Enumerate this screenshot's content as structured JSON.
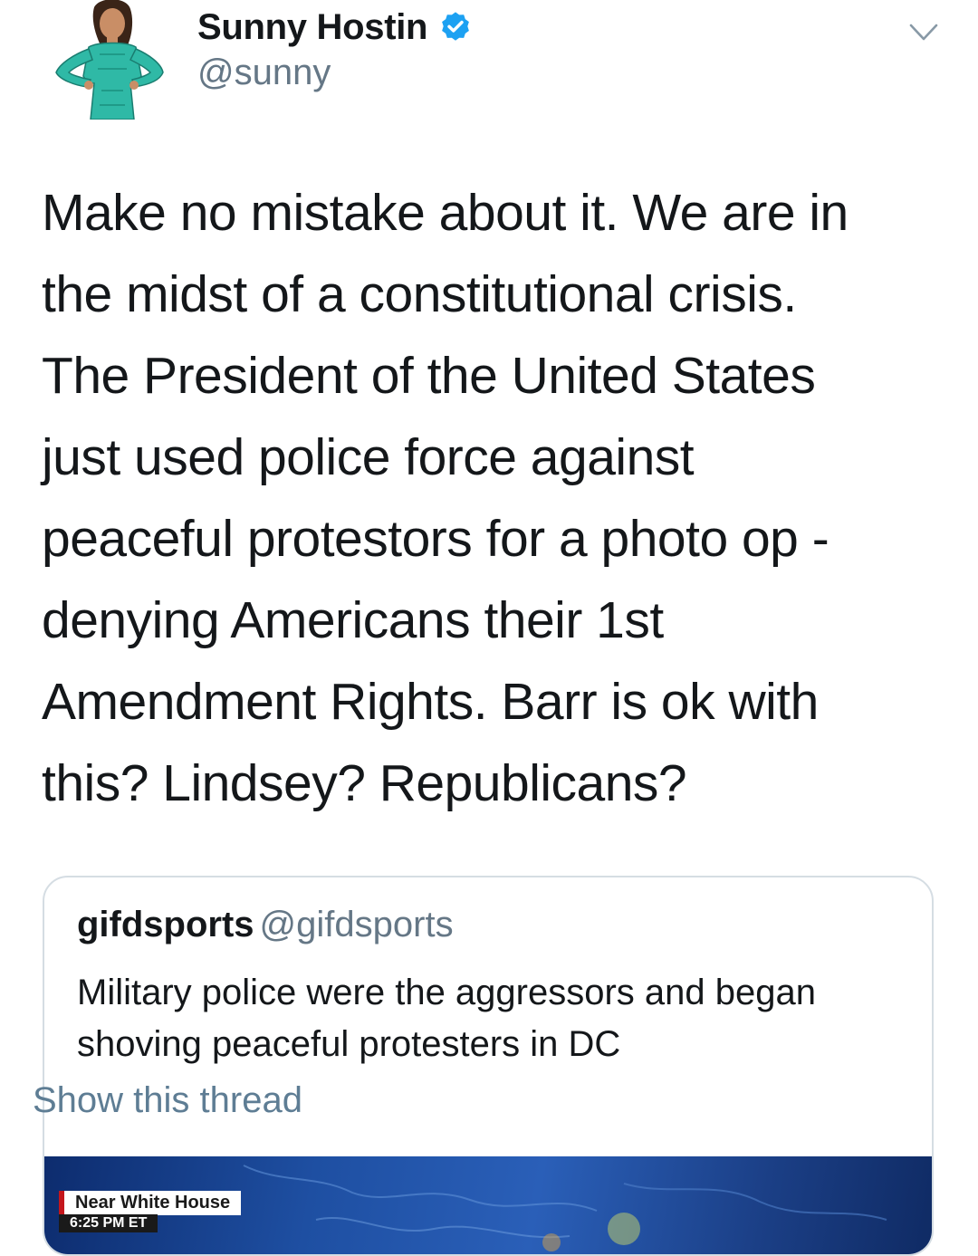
{
  "author": {
    "display_name": "Sunny Hostin",
    "handle": "@sunny",
    "verified": true,
    "avatar_icon": "illustrated-woman-avatar"
  },
  "menu": {
    "icon": "chevron-down-icon"
  },
  "tweet": {
    "lines": [
      "Make no mistake about it. We are in",
      "the midst of a constitutional crisis.",
      "The President of the United States",
      "just used police force against",
      "peaceful protestors for a photo op -",
      "denying Americans their 1st",
      "Amendment Rights. Barr is ok with",
      "this? Lindsey? Republicans?"
    ]
  },
  "quoted_tweet": {
    "display_name": "gifdsports",
    "handle": "@gifdsports",
    "lines": [
      "Military police were the aggressors and began",
      "shoving peaceful protesters in DC"
    ],
    "show_thread": "Show this thread",
    "media": {
      "chyron": "Near White House",
      "chyron_time": "6:25 PM ET"
    }
  },
  "colors": {
    "text": "#14171a",
    "secondary": "#657786",
    "link": "#5e7d94",
    "verified_blue": "#1da1f2",
    "border": "#d5dde3"
  }
}
